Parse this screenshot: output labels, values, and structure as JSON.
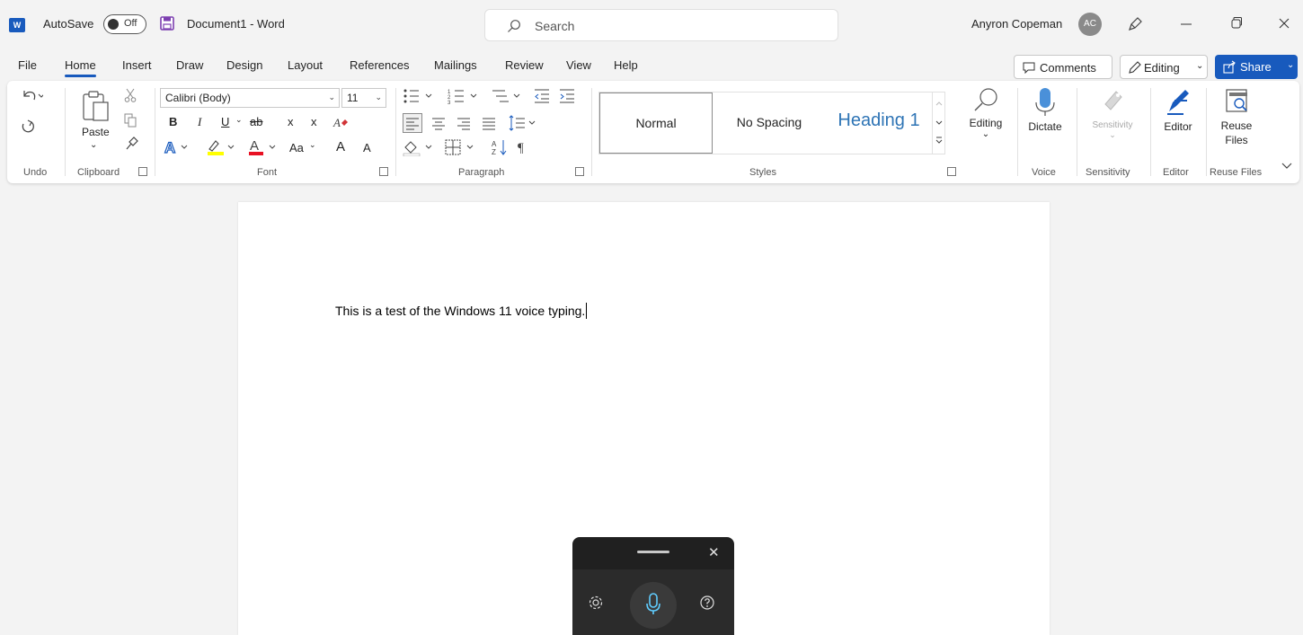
{
  "app": {
    "logo_text": "W",
    "autosave_label": "AutoSave",
    "autosave_state": "Off",
    "document_title": "Document1  -  Word",
    "search_placeholder": "Search",
    "user_name": "Anyron Copeman",
    "user_initials": "AC"
  },
  "tabs": [
    "File",
    "Home",
    "Insert",
    "Draw",
    "Design",
    "Layout",
    "References",
    "Mailings",
    "Review",
    "View",
    "Help"
  ],
  "active_tab": "Home",
  "tab_actions": {
    "comments": "Comments",
    "editing": "Editing",
    "share": "Share"
  },
  "ribbon": {
    "groups": {
      "undo": "Undo",
      "clipboard": "Clipboard",
      "font": "Font",
      "paragraph": "Paragraph",
      "styles": "Styles",
      "voice": "Voice",
      "sensitivity": "Sensitivity",
      "editor": "Editor",
      "reuse_files": "Reuse Files"
    },
    "paste_label": "Paste",
    "font_name": "Calibri (Body)",
    "font_size": "11",
    "font_buttons": {
      "bold": "B",
      "italic": "I",
      "underline": "U",
      "strike": "ab",
      "subscript": "x",
      "superscript": "x",
      "change_case": "Aa",
      "grow": "A",
      "shrink": "A"
    },
    "styles": [
      "Normal",
      "No Spacing",
      "Heading 1"
    ],
    "editing_label": "Editing",
    "dictate_label": "Dictate",
    "sensitivity_label": "Sensitivity",
    "editor_label": "Editor",
    "reuse_label_1": "Reuse",
    "reuse_label_2": "Files"
  },
  "document": {
    "text": "This is a test of the Windows 11 voice typing."
  },
  "colors": {
    "accent": "#185abd",
    "highlight": "#ffff00",
    "font_color": "#e81123",
    "heading": "#2e74b5"
  }
}
